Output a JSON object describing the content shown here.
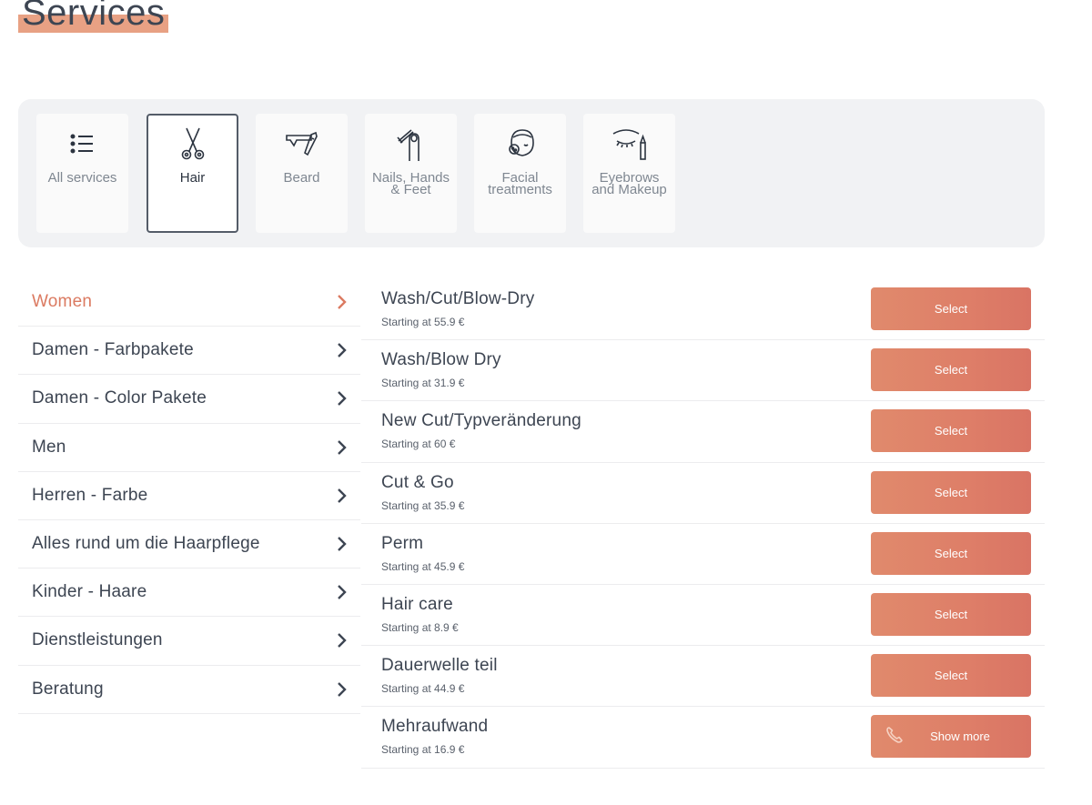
{
  "page": {
    "title": "Services"
  },
  "categories": [
    {
      "label": "All services",
      "icon": "list-icon",
      "active": false
    },
    {
      "label": "Hair",
      "icon": "scissors-icon",
      "active": true
    },
    {
      "label": "Beard",
      "icon": "razor-icon",
      "active": false
    },
    {
      "label": "Nails, Hands & Feet",
      "icon": "nail-polish-icon",
      "active": false
    },
    {
      "label": "Facial treatments",
      "icon": "face-mask-icon",
      "active": false
    },
    {
      "label": "Eyebrows and Makeup",
      "icon": "eyebrow-pencil-icon",
      "active": false
    }
  ],
  "subcategories": [
    {
      "label": "Women",
      "active": true
    },
    {
      "label": "Damen - Farbpakete",
      "active": false
    },
    {
      "label": "Damen - Color Pakete",
      "active": false
    },
    {
      "label": "Men",
      "active": false
    },
    {
      "label": "Herren - Farbe",
      "active": false
    },
    {
      "label": "Alles rund um die Haarpflege",
      "active": false
    },
    {
      "label": "Kinder - Haare",
      "active": false
    },
    {
      "label": "Dienstleistungen",
      "active": false
    },
    {
      "label": "Beratung",
      "active": false
    }
  ],
  "services": [
    {
      "name": "Wash/Cut/Blow-Dry",
      "price": "Starting at 55.9 €",
      "button": "Select"
    },
    {
      "name": "Wash/Blow Dry",
      "price": "Starting at 31.9 €",
      "button": "Select"
    },
    {
      "name": "New Cut/Typveränderung",
      "price": "Starting at 60 €",
      "button": "Select"
    },
    {
      "name": "Cut & Go",
      "price": "Starting at 35.9 €",
      "button": "Select"
    },
    {
      "name": "Perm",
      "price": "Starting at 45.9 €",
      "button": "Select"
    },
    {
      "name": "Hair care",
      "price": "Starting at 8.9 €",
      "button": "Select"
    },
    {
      "name": "Dauerwelle teil",
      "price": "Starting at 44.9 €",
      "button": "Select"
    },
    {
      "name": "Mehraufwand",
      "price": "Starting at 16.9 €",
      "button": "Show more",
      "icon": "phone-icon"
    }
  ],
  "colors": {
    "accent": "#db7a61",
    "title_highlight": "#e8a184",
    "text": "#3d4552",
    "panel": "#f1f2f4"
  }
}
